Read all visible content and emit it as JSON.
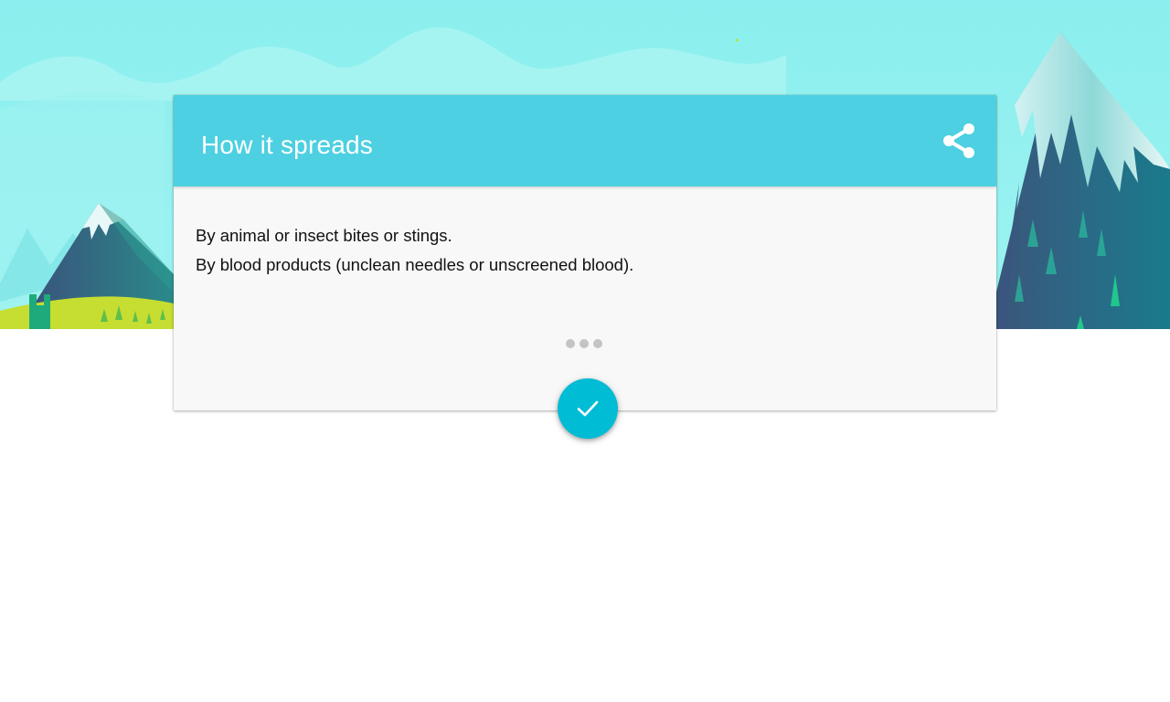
{
  "card": {
    "title": "How it spreads",
    "lines": [
      "By animal or insect bites or stings.",
      "By blood products (unclean needles or unscreened blood)."
    ],
    "page_indicator": {
      "total": 3
    }
  },
  "icons": {
    "share": "share-icon",
    "confirm": "check-icon"
  },
  "colors": {
    "header": "#4dd0e1",
    "fab": "#00bcd4",
    "sky": "#8eeeee",
    "mountain_dark": "#3a5a7e",
    "mountain_teal": "#1f6f88",
    "snow": "#e6f7f7",
    "meadow": "#c6dd32",
    "card_body": "#f8f8f8"
  }
}
